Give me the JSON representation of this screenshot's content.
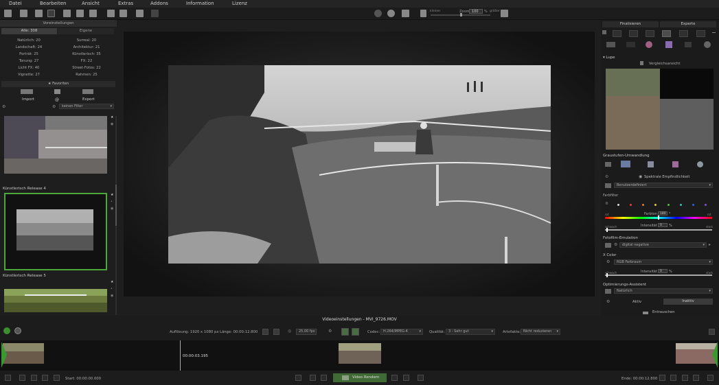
{
  "menu": [
    "Datei",
    "Bearbeiten",
    "Ansicht",
    "Extras",
    "Addons",
    "Information",
    "Lizenz"
  ],
  "toolbar": {
    "zoom_label": "Zoom",
    "zoom_value": "100",
    "zoom_unit": "%",
    "smaller": "kleiner",
    "bigger": "größer"
  },
  "left_panel": {
    "title": "Voreinstellungen",
    "tabs": [
      "Alle: 308",
      "Eigene"
    ],
    "categories": [
      [
        "Natürlich: 20",
        "Surreal: 20"
      ],
      [
        "Landschaft: 24",
        "Architektur: 21"
      ],
      [
        "Porträt: 25",
        "Künstlerisch: 35"
      ],
      [
        "Tonung: 27",
        "FX: 22"
      ],
      [
        "Licht FX: 40",
        "Street-Fotos: 22"
      ],
      [
        "Vignette: 27",
        "Rahmen: 25"
      ]
    ],
    "favorites": "★ Favoriten",
    "import": "Import",
    "export": "Export",
    "filter": "keinen Filter",
    "presets": [
      {
        "label": ""
      },
      {
        "label": "Künstlerisch Release 4"
      },
      {
        "label": "Künstlerisch Release 5"
      }
    ]
  },
  "right_panel": {
    "tabs": [
      "Finalisieren",
      "Experte"
    ],
    "lupe": "Lupe",
    "vergleich": "Vergleichsansicht",
    "graustufen": "Graustufen-Umwandlung",
    "spektral": "Spektrale Empfindlichkeit",
    "benutzer": "Benutzerdefiniert",
    "farbfilter": "Farbfilter",
    "farbton": "Farbton",
    "farbton_value": "180",
    "farbton_unit": "°",
    "rot": "rot",
    "rot2": "rot",
    "schwach": "schwach",
    "intensitaet": "Intensität",
    "int_value": "0",
    "int_unit": "%",
    "stark": "stark",
    "fotofilm": "Fotofilm-Emulation",
    "fotofilm_value": "digital negative",
    "xcolor": "X Color",
    "xcolor_value": "RGB Farbraum",
    "schwach2": "schwach",
    "intensitaet2": "Intensität",
    "int2_value": "0",
    "int2_unit": "%",
    "stark2": "stark",
    "optimierung": "Optimierungs-Assistent",
    "optimierung_value": "Natürlich",
    "aktiv": "Aktiv",
    "inaktiv": "Inaktiv",
    "entrauschen": "Entrauschen"
  },
  "video": {
    "title": "Videoeinstellungen - MVI_9726.MOV",
    "resolution": "Auflösung: 1920 x 1080 px",
    "length": "Länge: 00:00:12.800",
    "fps": "25,00 fps",
    "codec_label": "Codec:",
    "codec": "H.264/MPEG-4",
    "quality_label": "Qualität:",
    "quality": "3 - Sehr gut",
    "artifacts_label": "Artefakte:",
    "artifacts": "Nicht reduzieren",
    "cursor_time": "00:00:03.195",
    "start": "Start: 00:00:00.000",
    "end": "Ende: 00:00:12.800",
    "render": "Video Rendern"
  }
}
